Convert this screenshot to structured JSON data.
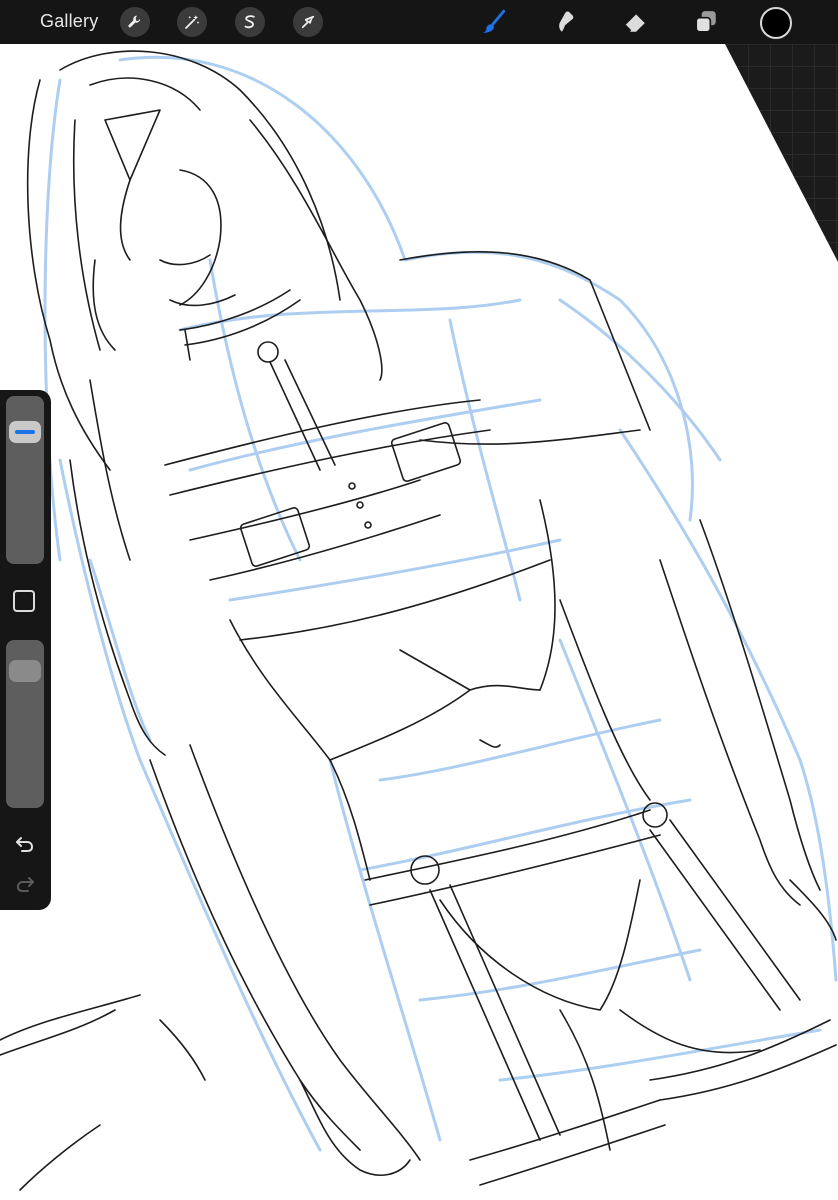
{
  "app": {
    "gallery_label": "Gallery"
  },
  "toolbar": {
    "left_tools": [
      "wrench-icon",
      "magic-wand-icon",
      "selection-icon",
      "transform-arrow-icon"
    ],
    "right_tools": [
      "brush-icon",
      "smudge-icon",
      "eraser-icon",
      "layers-icon"
    ],
    "active_tool": "brush-icon",
    "active_color": "#000000",
    "accent_color": "#1e72e8"
  },
  "sidebar": {
    "brush_size_level": 0.84,
    "opacity_level": 0.12,
    "buttons": [
      "modify-button",
      "undo-icon",
      "redo-icon"
    ]
  }
}
